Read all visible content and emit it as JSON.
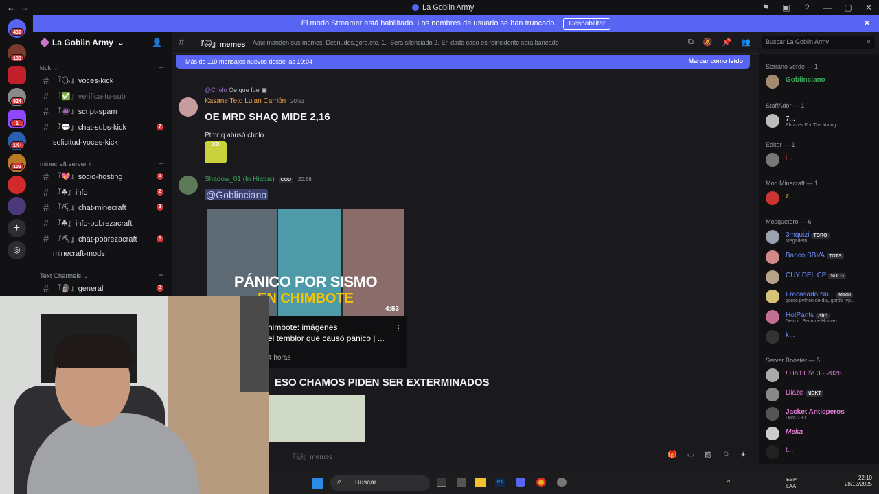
{
  "window": {
    "title": "La Goblin Army"
  },
  "banner": {
    "text": "El modo Streamer está habilitado. Los nombres de usuario se han truncado.",
    "button": "Deshabilitar"
  },
  "rail": {
    "badges": [
      "439",
      "133",
      "924",
      "1",
      "1K+",
      "102"
    ]
  },
  "sidebar": {
    "guild": "La Goblin Army",
    "categories": [
      {
        "name": "kick"
      },
      {
        "name": "minecraft server"
      },
      {
        "name": "Text Channels"
      }
    ],
    "channels": [
      {
        "label": "『🗣』voces-kick",
        "badge": ""
      },
      {
        "label": "『✅』verifica-tu-sub",
        "badge": ""
      },
      {
        "label": "『👾』script-spam",
        "badge": ""
      },
      {
        "label": "『💬』chat-subs-kick",
        "badge": "7"
      },
      {
        "label": "solicitud-voces-kick",
        "badge": ""
      },
      {
        "label": "『💖』socio-hosting",
        "badge": "1"
      },
      {
        "label": "『☘』info",
        "badge": "2"
      },
      {
        "label": "『⛏』chat-minecraft",
        "badge": "3"
      },
      {
        "label": "『☘』info-pobrezacraft",
        "badge": ""
      },
      {
        "label": "『⛏』chat-pobrezacraft",
        "badge": "1"
      },
      {
        "label": "minecraft-mods",
        "badge": ""
      },
      {
        "label": "『🗿』general",
        "badge": "3"
      }
    ]
  },
  "header": {
    "channel": "『🐱』memes",
    "topic": "Aqui manden sus memes. Desnudos,gore,etc. 1.- Sera silenciado 2.-En dado caso es reincidente sera baneado",
    "search_placeholder": "Buscar La Goblin Army"
  },
  "newbar": {
    "text": "Más de 110 mensajes nuevos desde las 19:04",
    "action": "Marcar como leído"
  },
  "messages": {
    "m1": {
      "reply_name": "@Cholo",
      "reply_text": "Oe que fue",
      "author": "Kasane Teto Lujan Carrión",
      "time": "20:53",
      "big_text": "OE MRD SHAQ MIDE 2,16",
      "text": "Ptmr q abusó cholo",
      "sticker": "XD"
    },
    "m2": {
      "author": "Shadow_01 (In Hiatus)",
      "tag": "COD",
      "time": "20:58",
      "mention": "@Goblinciano",
      "thumb_line1": "PÁNICO POR SISMO",
      "thumb_line2": "EN CHIMBOTE",
      "duration": "4:53",
      "video_line1": "himbote: imágenes",
      "video_line2": "el temblor que causó pánico | ...",
      "video_line3": "4 horas",
      "big_text2": "ESO CHAMOS PIDEN SER EXTERMINADOS"
    }
  },
  "composer": {
    "placeholder": "『🐱』memes"
  },
  "members": {
    "roles": [
      "Serrano verde — 1",
      "StaffAdor — 1",
      "Editor — 1",
      "Mod Minecraft — 1",
      "Mosquetero — 6",
      "Server Booster — 5"
    ],
    "list": [
      {
        "name": "Goblinciano",
        "sub": "",
        "tag": "",
        "color": "#3ba55d"
      },
      {
        "name": "7...",
        "sub": "Phrazes For The Young",
        "tag": "",
        "color": "#f2f3f5"
      },
      {
        "name": "i...",
        "sub": "",
        "tag": "",
        "color": "#da373c"
      },
      {
        "name": "z...",
        "sub": "",
        "tag": "",
        "color": "#f0d147"
      },
      {
        "name": "3mquizi",
        "sub": "Megadeth",
        "tag": "TORO",
        "color": "#6b8afd"
      },
      {
        "name": "Banco BBVA",
        "sub": "",
        "tag": "TOTS",
        "color": "#6b8afd"
      },
      {
        "name": "CUY DEL CP",
        "sub": "",
        "tag": "SDLG",
        "color": "#6b8afd"
      },
      {
        "name": "Fracasado Nu...",
        "sub": "gordo python de dia, gordo typ...",
        "tag": "MIKU",
        "color": "#6b8afd"
      },
      {
        "name": "HotPants",
        "sub": "Detroit: Become Human",
        "tag": "Ahri",
        "color": "#6b8afd"
      },
      {
        "name": "k...",
        "sub": "",
        "tag": "",
        "color": "#6b8afd"
      },
      {
        "name": "! Half Life 3 - 2026",
        "sub": "",
        "tag": "",
        "color": "#e37ed9"
      },
      {
        "name": "Diaze",
        "sub": "",
        "tag": "MDKT",
        "color": "#e37ed9"
      },
      {
        "name": "Jacket Anticperos",
        "sub": "Dota 2 +1",
        "tag": "",
        "color": "#e37ed9"
      },
      {
        "name": "Meka",
        "sub": "",
        "tag": "",
        "color": "#e37ed9"
      },
      {
        "name": "t...",
        "sub": "",
        "tag": "",
        "color": "#e37ed9"
      }
    ]
  },
  "taskbar": {
    "search": "Buscar",
    "lang1": "ESP",
    "lang2": "LAA",
    "time": "22:10",
    "date": "28/12/2025"
  }
}
